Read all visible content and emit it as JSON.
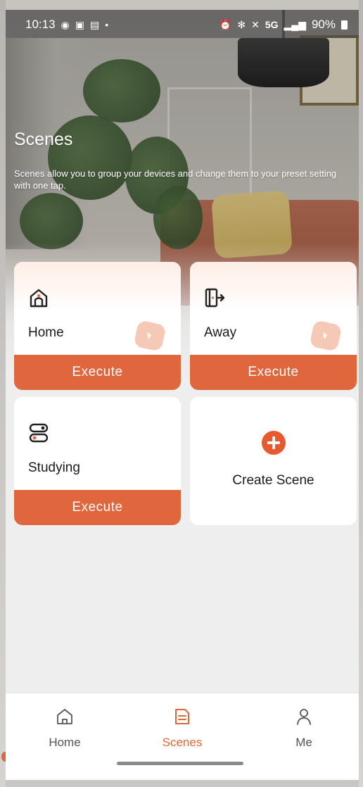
{
  "status_bar": {
    "time": "10:13",
    "left_icons": [
      "chrome-icon",
      "gallery-icon",
      "calendar-icon",
      "dot-icon"
    ],
    "right_icons": [
      "alarm-icon",
      "bluetooth-icon",
      "mute-icon"
    ],
    "network": "5G",
    "battery": "90%"
  },
  "header": {
    "title": "Scenes",
    "description": "Scenes allow you to group your devices and change them to your preset setting with one tap."
  },
  "scenes": [
    {
      "name": "Home",
      "icon": "home-door-icon",
      "action_label": "Execute"
    },
    {
      "name": "Away",
      "icon": "exit-door-icon",
      "action_label": "Execute"
    },
    {
      "name": "Studying",
      "icon": "toggles-icon",
      "action_label": "Execute"
    }
  ],
  "create_scene": {
    "label": "Create Scene",
    "icon": "plus-circle-icon"
  },
  "bottom_nav": {
    "items": [
      {
        "label": "Home",
        "icon": "home-icon",
        "active": false
      },
      {
        "label": "Scenes",
        "icon": "scenes-icon",
        "active": true
      },
      {
        "label": "Me",
        "icon": "person-icon",
        "active": false
      }
    ]
  },
  "colors": {
    "accent": "#e0663e",
    "plus": "#e55a2f",
    "inactive_nav": "#555555",
    "card_bg": "#ffffff"
  }
}
